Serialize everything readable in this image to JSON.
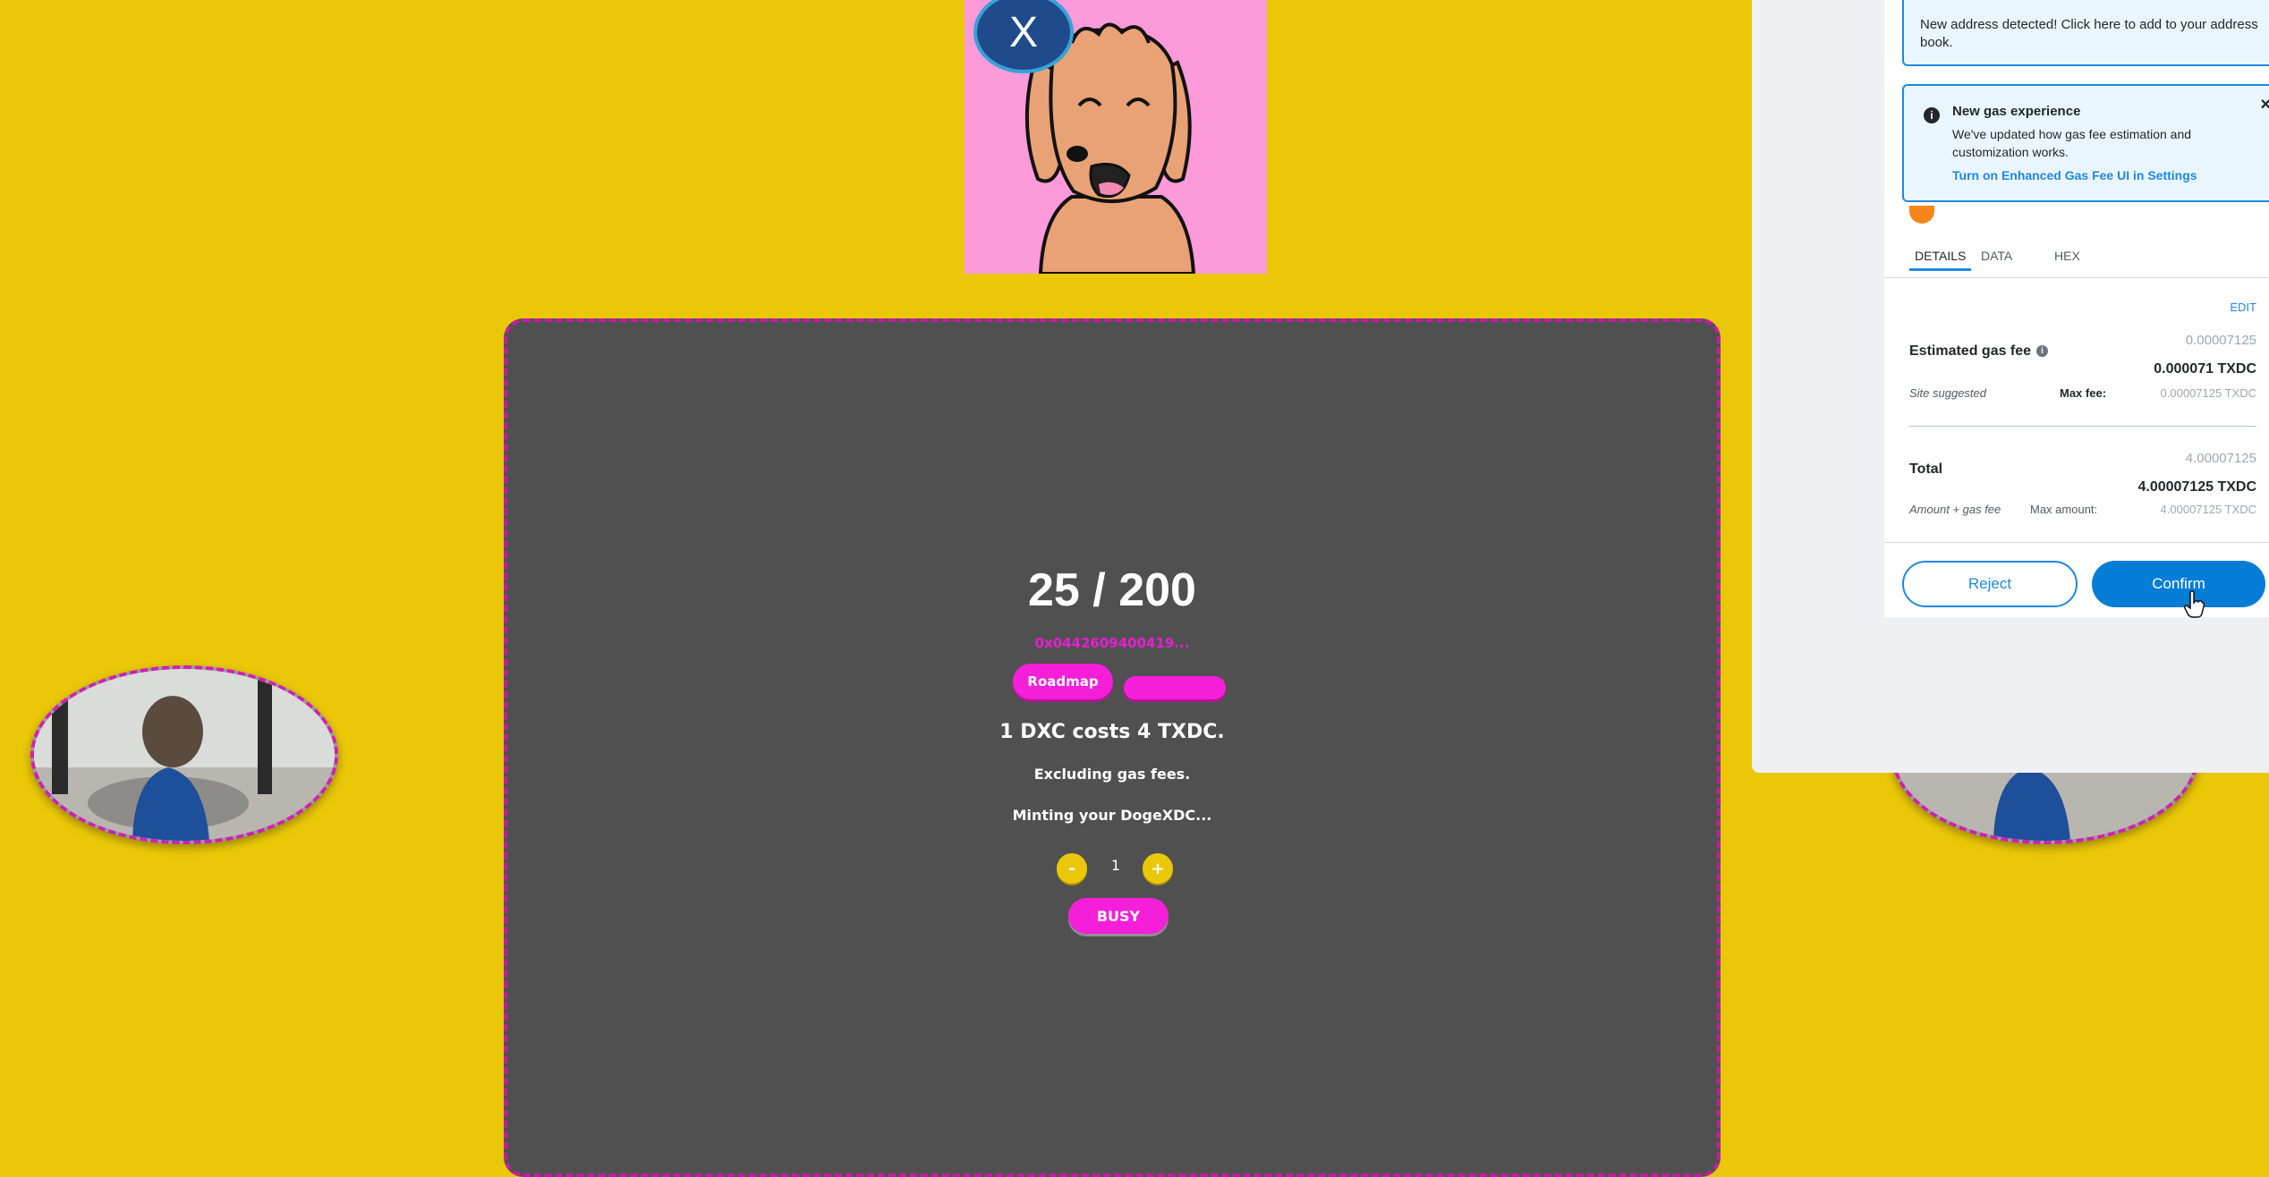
{
  "logo": {
    "badge_letter": "X"
  },
  "mint": {
    "supply": "25 / 200",
    "contract_address": "0x0442609400419...",
    "roadmap_label": "Roadmap",
    "price_text": "1 DXC costs 4 TXDC.",
    "gas_text": "Excluding gas fees.",
    "status_text": "Minting your DogeXDC...",
    "decrement_label": "-",
    "quantity": "1",
    "increment_label": "+",
    "mint_button_label": "BUSY"
  },
  "wallet": {
    "address_notice": "New address detected! Click here to add to your address book.",
    "gas_notice": {
      "info_icon": "i",
      "title": "New gas experience",
      "body": "We've updated how gas fee estimation and customization works.",
      "link": "Turn on Enhanced Gas Fee UI in Settings",
      "close": "×"
    },
    "tabs": [
      "DETAILS",
      "DATA",
      "HEX"
    ],
    "edit_label": "EDIT",
    "gas_fee": {
      "title": "Estimated gas fee",
      "info_icon": "i",
      "muted_value": "0.00007125",
      "value": "0.000071 TXDC",
      "sub_label": "Site suggested",
      "max_label": "Max fee:",
      "max_value": "0.00007125 TXDC"
    },
    "total": {
      "title": "Total",
      "muted_value": "4.00007125",
      "value": "4.00007125 TXDC",
      "sub_label": "Amount + gas fee",
      "max_label": "Max amount:",
      "max_value": "4.00007125 TXDC"
    },
    "reject_label": "Reject",
    "confirm_label": "Confirm"
  },
  "colors": {
    "background": "#ebc807",
    "card": "#505050",
    "accent_pink": "#f51fd9",
    "wallet_blue": "#037dd6"
  }
}
